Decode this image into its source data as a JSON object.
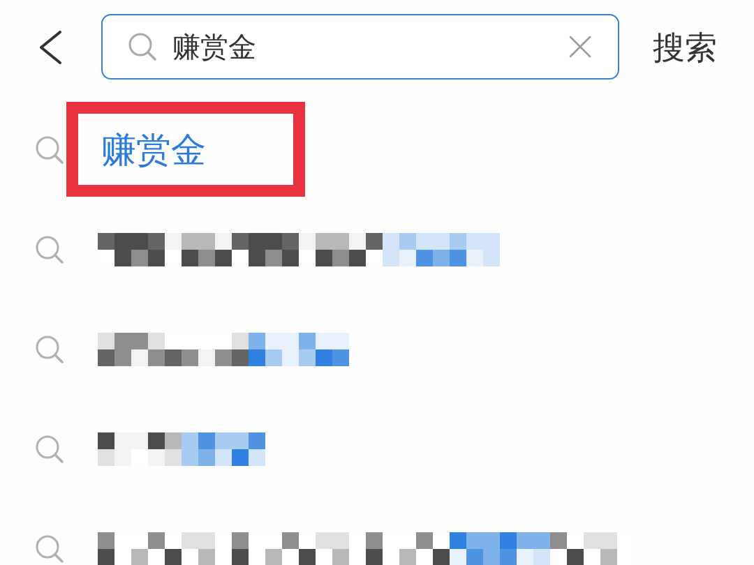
{
  "search": {
    "value": "赚赏金",
    "button": "搜索"
  },
  "suggestions": [
    {
      "kind": "text",
      "text": "赚赏金",
      "highlighted": true
    },
    {
      "kind": "pixelated",
      "highlighted": false
    },
    {
      "kind": "pixelated",
      "highlighted": false
    },
    {
      "kind": "pixelated",
      "highlighted": false
    },
    {
      "kind": "pixelated",
      "highlighted": false
    }
  ]
}
